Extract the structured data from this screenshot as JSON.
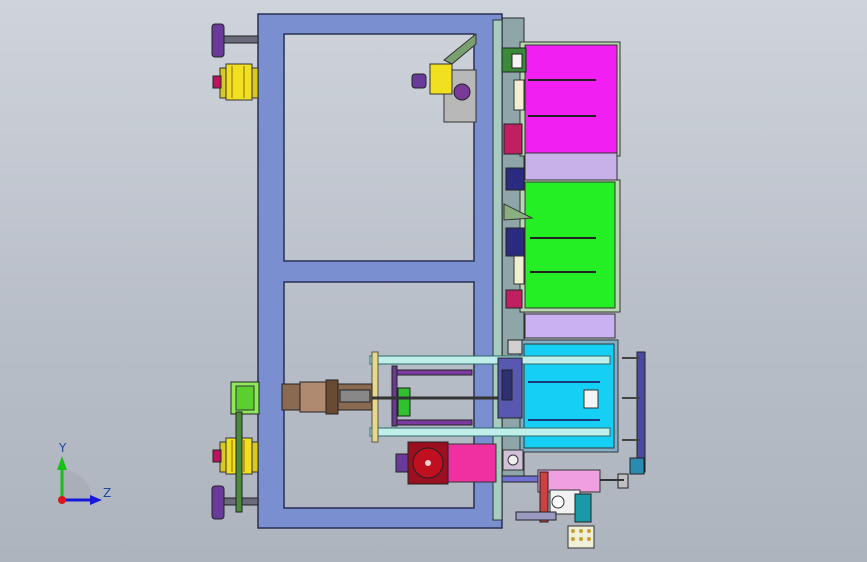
{
  "triad": {
    "y_label": "Y",
    "z_label": "Z",
    "y_color": "#18c018",
    "z_color": "#1818d8",
    "x_color": "#d81818"
  },
  "colors": {
    "frame": "#7a8fd0",
    "frame_edge": "#3a3f60",
    "magenta_box": "#f21ff2",
    "green_box": "#24ee24",
    "cyan_box": "#16cff5",
    "lilac_panel": "#c9b1f2",
    "light_green_plate": "#a9e0a0",
    "yellow_part": "#f0e020",
    "purple_part": "#6a3a9a",
    "red_motor": "#c01020",
    "pink_motor": "#f030a0"
  }
}
